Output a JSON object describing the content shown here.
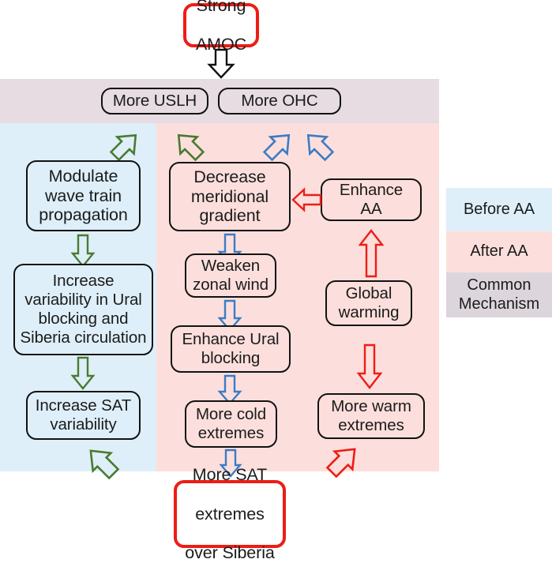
{
  "diagram": {
    "title_node": {
      "line1": "Strong",
      "line2": "AMOC"
    },
    "bottom_node": {
      "line1": "More SAT",
      "line2": "extremes",
      "line3": "over Siberia"
    },
    "common_band": {
      "boxes": [
        {
          "label": "More USLH"
        },
        {
          "label": "More OHC"
        }
      ]
    },
    "before_aa_column": {
      "boxes": [
        {
          "label": "Modulate\nwave train\npropagation"
        },
        {
          "label": "Increase\nvariability in Ural\nblocking and\nSiberia circulation"
        },
        {
          "label": "Increase SAT\nvariability"
        }
      ]
    },
    "after_aa_column": {
      "center_boxes": [
        {
          "label": "Decrease\nmeridional\ngradient"
        },
        {
          "label": "Weaken\nzonal wind"
        },
        {
          "label": "Enhance Ural\nblocking"
        },
        {
          "label": "More cold\nextremes"
        }
      ],
      "right_boxes": [
        {
          "label": "Enhance\nAA"
        },
        {
          "label": "Global\nwarming"
        },
        {
          "label": "More warm\nextremes"
        }
      ]
    },
    "legend": {
      "items": [
        {
          "label": "Before AA",
          "color": "#deeff9"
        },
        {
          "label": "After AA",
          "color": "#fcdfdc"
        },
        {
          "label": "Common\nMechanism",
          "color": "#dcd6dc"
        }
      ]
    },
    "colors": {
      "green_arrow": "#4a7a30",
      "blue_arrow": "#3b7cc4",
      "red_arrow": "#ee1c15",
      "black_arrow": "#121212",
      "before_aa_bg": "#deeff9",
      "after_aa_bg": "#fcdfdc",
      "common_bg": "#e6dce2",
      "node_border": "#121212",
      "emphasis_border": "#ee1c15"
    },
    "arrows": [
      {
        "name": "amoc-to-common",
        "color": "black",
        "direction": "down"
      },
      {
        "name": "uslh-to-modulate",
        "color": "green",
        "direction": "down-left"
      },
      {
        "name": "uslh-to-decrease-gradient",
        "color": "green",
        "direction": "down-right"
      },
      {
        "name": "ohc-to-decrease-gradient",
        "color": "blue",
        "direction": "down-left"
      },
      {
        "name": "ohc-to-enhance-aa",
        "color": "blue",
        "direction": "down-right"
      },
      {
        "name": "modulate-to-increase-variability",
        "color": "green",
        "direction": "down"
      },
      {
        "name": "increase-variability-to-increase-sat",
        "color": "green",
        "direction": "down"
      },
      {
        "name": "increase-sat-to-more-sat-extremes",
        "color": "green",
        "direction": "down-right"
      },
      {
        "name": "decrease-gradient-to-weaken-wind",
        "color": "blue",
        "direction": "down"
      },
      {
        "name": "weaken-wind-to-enhance-blocking",
        "color": "blue",
        "direction": "down"
      },
      {
        "name": "enhance-blocking-to-more-cold",
        "color": "blue",
        "direction": "down"
      },
      {
        "name": "more-cold-to-more-sat-extremes",
        "color": "blue",
        "direction": "down"
      },
      {
        "name": "enhance-aa-to-decrease-gradient",
        "color": "red",
        "direction": "left"
      },
      {
        "name": "global-warming-to-enhance-aa",
        "color": "red",
        "direction": "up"
      },
      {
        "name": "global-warming-to-more-warm",
        "color": "red",
        "direction": "down"
      },
      {
        "name": "more-warm-to-more-sat-extremes",
        "color": "red",
        "direction": "down-left"
      }
    ]
  }
}
